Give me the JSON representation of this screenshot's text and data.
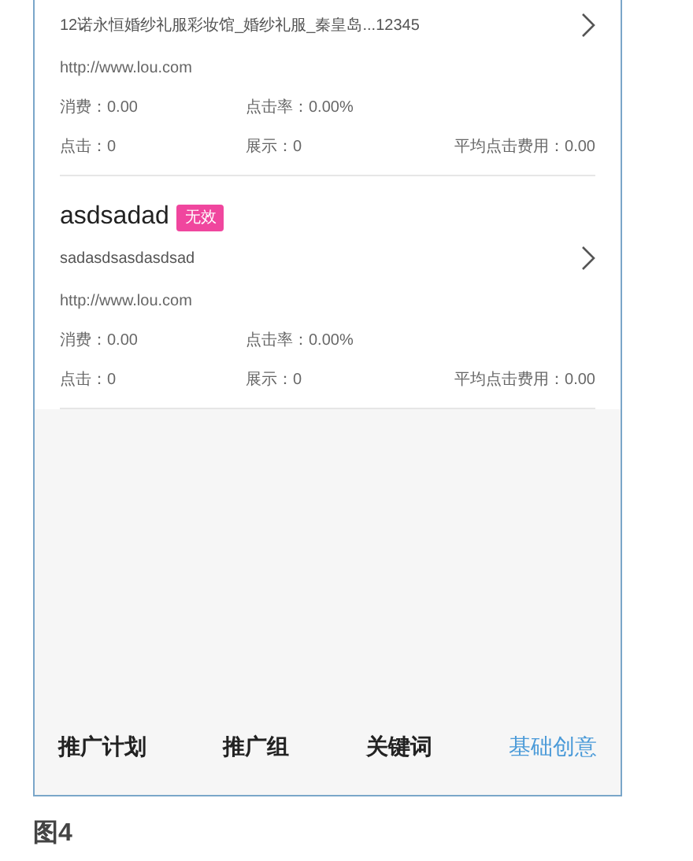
{
  "ads": [
    {
      "subtitle": "12诺永恒婚纱礼服彩妆馆_婚纱礼服_秦皇岛...12345",
      "url": "http://www.lou.com",
      "stats": [
        [
          "消费：0.00",
          "点击率：0.00%"
        ],
        [
          "点击：0",
          "展示：0",
          "平均点击费用：0.00"
        ]
      ]
    },
    {
      "name": "asdsadad",
      "badge": "无效",
      "subtitle": "sadasdsasdasdsad",
      "url": "http://www.lou.com",
      "stats": [
        [
          "消费：0.00",
          "点击率：0.00%"
        ],
        [
          "点击：0",
          "展示：0",
          "平均点击费用：0.00"
        ]
      ]
    }
  ],
  "tabs": [
    {
      "label": "推广计划",
      "selected": false
    },
    {
      "label": "推广组",
      "selected": false
    },
    {
      "label": "关键词",
      "selected": false
    },
    {
      "label": "基础创意",
      "selected": true
    }
  ],
  "caption": "图4"
}
